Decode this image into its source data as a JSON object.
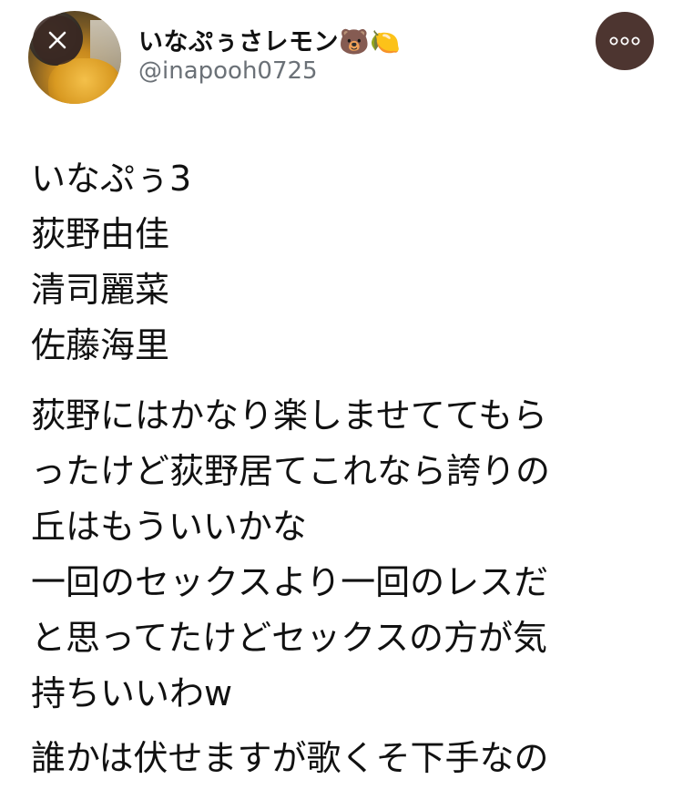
{
  "header": {
    "display_name": "いなぷぅさレモン🐻🍋",
    "handle": "@inapooh0725"
  },
  "icons": {
    "close": "close-icon",
    "more": "more-options-icon"
  },
  "tweet": {
    "paragraph1": [
      "いなぷぅ3",
      "荻野由佳",
      "清司麗菜",
      "佐藤海里"
    ],
    "paragraph2": [
      "荻野にはかなり楽しませててもら",
      "ったけど荻野居てこれなら誇りの",
      "丘はもういいかな",
      "一回のセックスより一回のレスだ",
      "と思ってたけどセックスの方が気",
      "持ちいいわw"
    ],
    "paragraph3": [
      "誰かは伏せますが歌くそ下手なの"
    ]
  },
  "colors": {
    "button_bg": "#4d3530",
    "handle_text": "#6b7177"
  }
}
